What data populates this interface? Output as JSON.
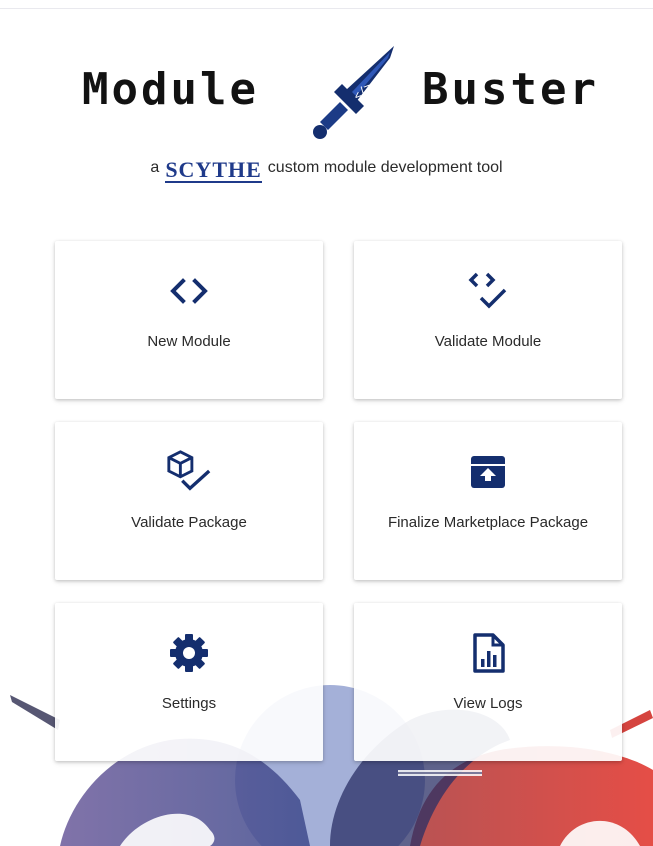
{
  "header": {
    "title_left": "Module",
    "title_right": "Buster",
    "tagline_prefix": "a",
    "tagline_brand": "SCYTHE",
    "tagline_suffix": "custom module development tool"
  },
  "colors": {
    "accent": "#142e6e",
    "text": "#2a2a2a",
    "logo_text": "#121212"
  },
  "cards": [
    {
      "label": "New Module",
      "icon": "code-brackets-icon"
    },
    {
      "label": "Validate Module",
      "icon": "code-check-icon"
    },
    {
      "label": "Validate Package",
      "icon": "package-check-icon"
    },
    {
      "label": "Finalize Marketplace Package",
      "icon": "archive-upload-icon"
    },
    {
      "label": "Settings",
      "icon": "gear-icon"
    },
    {
      "label": "View Logs",
      "icon": "log-chart-icon"
    }
  ]
}
